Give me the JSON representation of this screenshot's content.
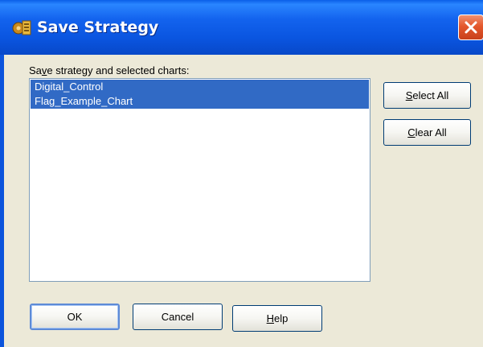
{
  "window": {
    "title": "Save Strategy",
    "icon": "strategy-gear-icon",
    "close_icon": "close-icon"
  },
  "prompt": {
    "pre": "Sa",
    "accel": "v",
    "post": "e strategy and selected charts:"
  },
  "charts_list": {
    "items": [
      {
        "label": "Digital_Control",
        "selected": true
      },
      {
        "label": "Flag_Example_Chart",
        "selected": true
      }
    ]
  },
  "buttons": {
    "select_all": {
      "accel": "S",
      "rest": "elect All"
    },
    "clear_all": {
      "accel": "C",
      "rest": "lear All"
    },
    "ok": {
      "label": "OK"
    },
    "cancel": {
      "label": "Cancel"
    },
    "help": {
      "accel": "H",
      "rest": "elp"
    }
  },
  "colors": {
    "titlebar": "#0a55e0",
    "selection": "#316ac5",
    "dialog_face": "#ece9d8",
    "close_button": "#e4582c"
  }
}
